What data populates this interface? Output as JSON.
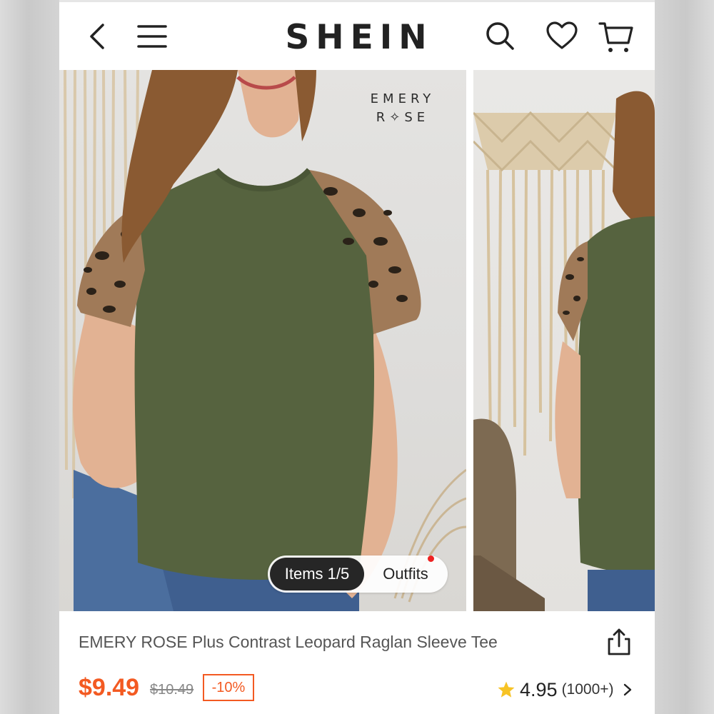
{
  "header": {
    "logo": "SHEIN",
    "icons": [
      "chevron-left-icon",
      "menu-icon",
      "search-icon",
      "heart-icon",
      "cart-icon"
    ]
  },
  "gallery": {
    "brand_line1": "EMERY",
    "brand_line2": "R✧SE",
    "items_label": "Items 1/5",
    "outfits_label": "Outfits"
  },
  "product": {
    "title": "EMERY ROSE Plus Contrast Leopard Raglan Sleeve Tee",
    "price": "$9.49",
    "original_price": "$10.49",
    "discount": "-10%",
    "rating": "4.95",
    "review_count": "(1000+)"
  },
  "colors": {
    "accent": "#f35a22",
    "star": "#f7c325",
    "shirt": "#56633f"
  }
}
